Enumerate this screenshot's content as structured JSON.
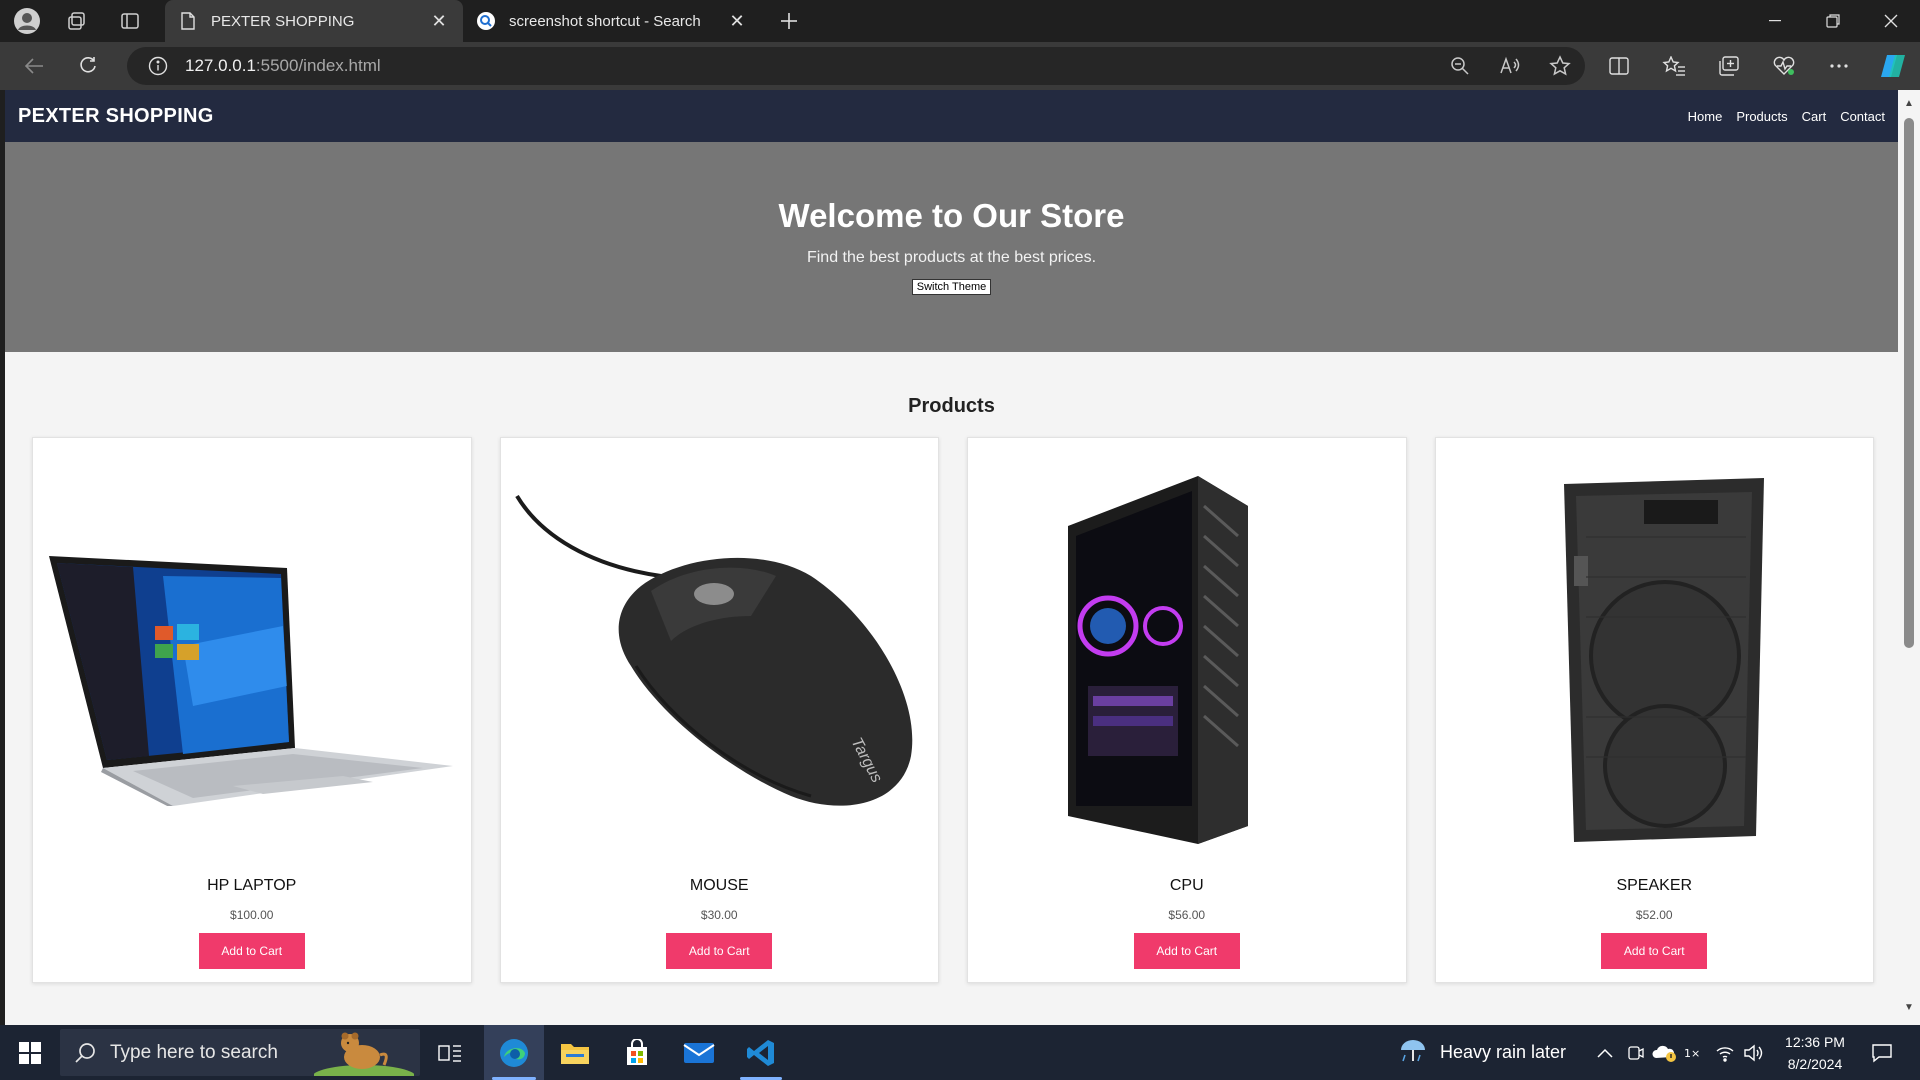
{
  "browser": {
    "tabs": [
      {
        "title": "PEXTER SHOPPING",
        "active": true
      },
      {
        "title": "screenshot shortcut - Search",
        "active": false
      }
    ],
    "url": {
      "host": "127.0.0.1",
      "rest": ":5500/index.html"
    }
  },
  "site": {
    "brand": "PEXTER SHOPPING",
    "nav": [
      "Home",
      "Products",
      "Cart",
      "Contact"
    ],
    "hero": {
      "title": "Welcome to Our Store",
      "subtitle": "Find the best products at the best prices.",
      "button": "Switch Theme"
    },
    "products_title": "Products",
    "products": [
      {
        "name": "HP LAPTOP",
        "price": "$100.00",
        "button": "Add to Cart",
        "icon": "laptop-image"
      },
      {
        "name": "MOUSE",
        "price": "$30.00",
        "button": "Add to Cart",
        "icon": "mouse-image"
      },
      {
        "name": "CPU",
        "price": "$56.00",
        "button": "Add to Cart",
        "icon": "cpu-case-image"
      },
      {
        "name": "SPEAKER",
        "price": "$52.00",
        "button": "Add to Cart",
        "icon": "speaker-image"
      }
    ],
    "accent_color": "#f03a6b",
    "header_color": "#232a40",
    "hero_color": "#767676"
  },
  "taskbar": {
    "search_placeholder": "Type here to search",
    "weather": "Heavy rain later",
    "time": "12:36 PM",
    "date": "8/2/2024"
  }
}
